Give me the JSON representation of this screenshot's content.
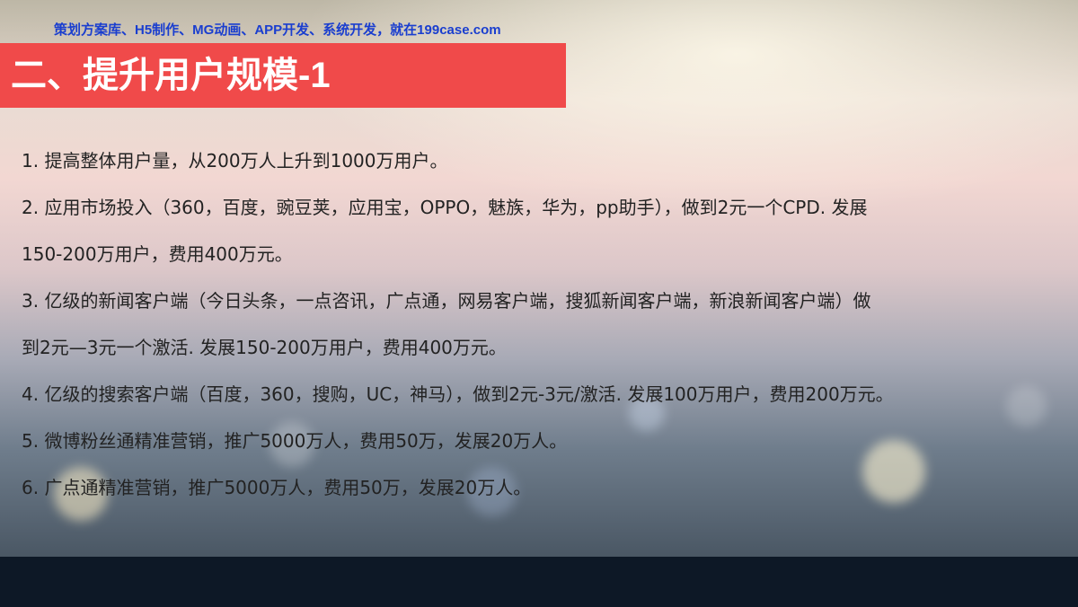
{
  "watermark": "策划方案库、H5制作、MG动画、APP开发、系统开发，就在199case.com",
  "slide": {
    "title": "二、提升用户规模-1",
    "lines": [
      "1. 提高整体用户量，从200万人上升到1000万用户。",
      "2. 应用市场投入（360，百度，豌豆荚，应用宝，OPPO，魅族，华为，pp助手），做到2元一个CPD. 发展",
      "150-200万用户，费用400万元。",
      "3. 亿级的新闻客户端（今日头条，一点咨讯，广点通，网易客户端，搜狐新闻客户端，新浪新闻客户端）做",
      "到2元—3元一个激活. 发展150-200万用户，费用400万元。",
      "4. 亿级的搜索客户端（百度，360，搜购，UC，神马），做到2元-3元/激活. 发展100万用户，费用200万元。",
      "5. 微博粉丝通精准营销，推广5000万人，费用50万，发展20万人。",
      "6. 广点通精准营销，推广5000万人，费用50万，发展20万人。"
    ]
  },
  "colors": {
    "title_bar": "#f04a4a",
    "watermark": "#1a3ecf",
    "footer_band": "#0d1826"
  }
}
